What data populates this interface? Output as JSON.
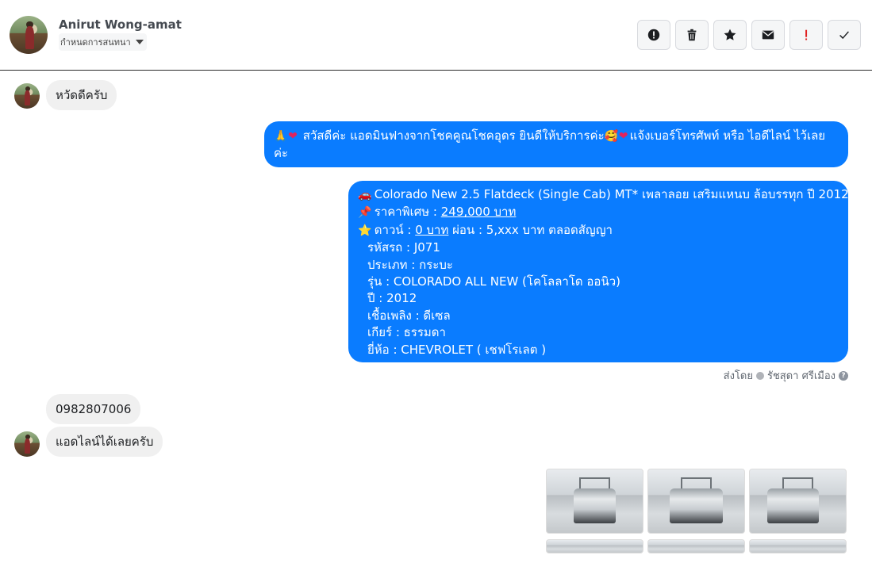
{
  "header": {
    "name": "Anirut Wong-amat",
    "status_label": "กำหนดการสนทนา"
  },
  "actions": [
    {
      "name": "report-button",
      "icon": "exclamation-circle-icon"
    },
    {
      "name": "delete-button",
      "icon": "trash-icon"
    },
    {
      "name": "star-button",
      "icon": "star-icon"
    },
    {
      "name": "mail-button",
      "icon": "envelope-icon"
    },
    {
      "name": "important-button",
      "icon": "exclamation-icon",
      "color": "#e02020"
    },
    {
      "name": "done-button",
      "icon": "check-icon"
    }
  ],
  "messages": {
    "m1": "หวัดดีครับ",
    "m2_line1": "สวัสดีค่ะ แอดมินฟางจากโชคคูณโชคอุดร ยินดีให้บริการค่ะ",
    "m2_line1b": "แจ้งเบอร์โทรศัพท์ หรือ ไอดีไลน์  ไว้เลย",
    "m2_line2": "ค่ะ",
    "car": {
      "title": "Colorado New 2.5 Flatdeck (Single Cab) MT* เพลาลอย เสริมแหนบ ล้อบรรทุก  ปี 2012",
      "price_label": "ราคาพิเศษ : ",
      "price": "249,000 บาท",
      "down_label": "ดาวน์ : ",
      "down": "0 บาท",
      "down_rest": " ผ่อน : 5,xxx บาท ตลอดสัญญา",
      "code": "รหัสรถ : J071",
      "type": "ประเภท : กระบะ",
      "model": "รุ่น : COLORADO ALL NEW (โคโลลาโด ออนิว)",
      "year": "ปี : 2012",
      "fuel": "เชื้อเพลิง : ดีเซล",
      "gear": "เกียร์ : ธรรมดา",
      "brand": "ยี่ห้อ : CHEVROLET ( เชฟโรเลต )"
    },
    "sent_by_label": "ส่งโดย",
    "sent_by_name": "รัชสุดา ศรีเมือง",
    "phone": "0982807006",
    "m4": "แอดไลน์ได้เลยครับ"
  },
  "colors": {
    "outgoing_bubble": "#0a7cff",
    "incoming_bubble": "#f0f0f0"
  }
}
